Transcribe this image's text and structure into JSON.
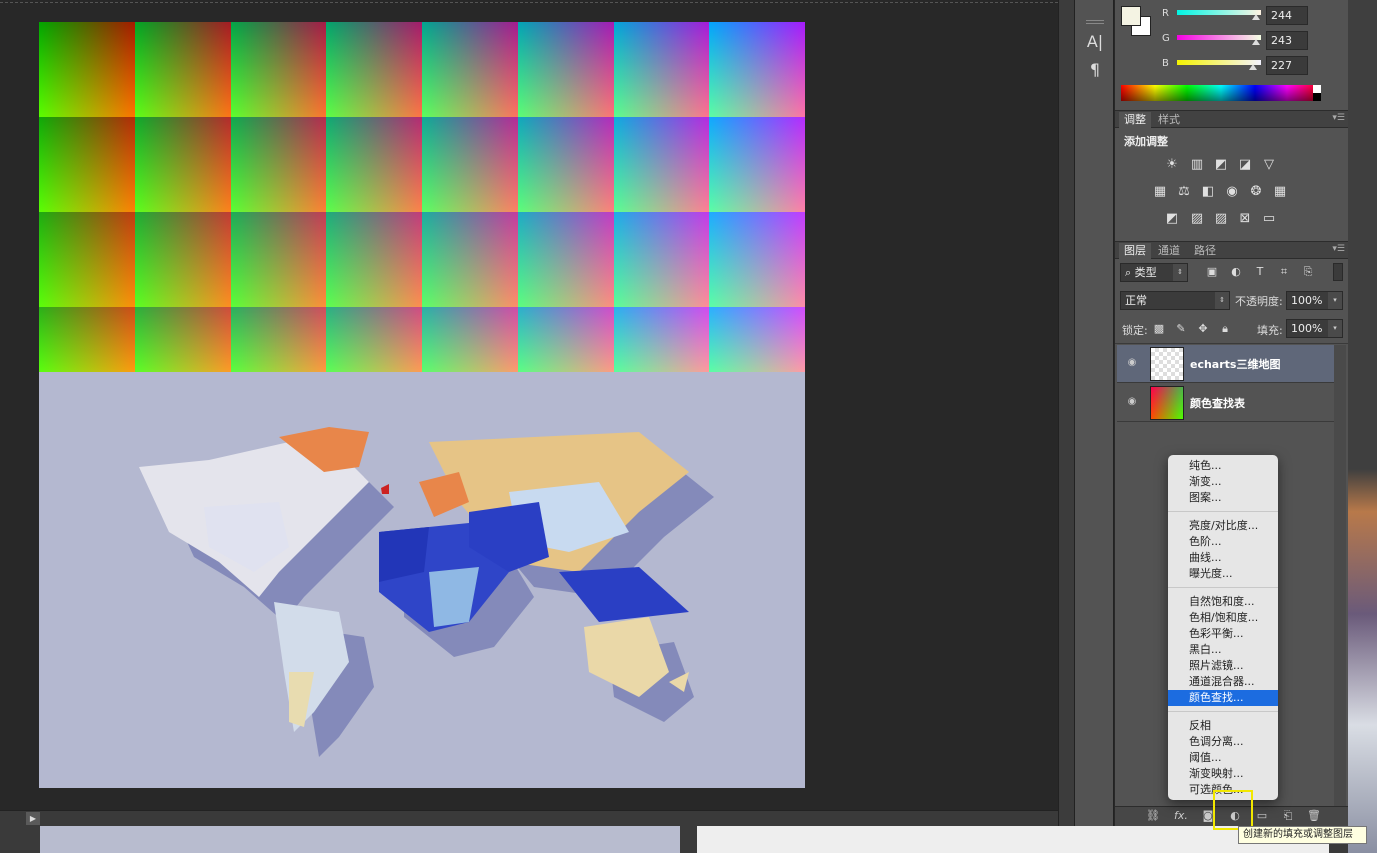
{
  "color_panel": {
    "foreground_hex": "#f4f3e3",
    "background_hex": "#ffffff",
    "channels": [
      {
        "label": "R",
        "value": "244"
      },
      {
        "label": "G",
        "value": "243"
      },
      {
        "label": "B",
        "value": "227"
      }
    ]
  },
  "tools": {
    "text_icon": "A|",
    "paragraph_icon": "¶"
  },
  "adjustments_panel": {
    "tabs": [
      "调整",
      "样式"
    ],
    "title": "添加调整",
    "icons_row1": [
      "brightness-icon",
      "levels-icon",
      "curves-icon",
      "exposure-icon",
      "vibrance-icon"
    ],
    "icons_row2": [
      "hue-saturation-icon",
      "color-balance-icon",
      "black-white-icon",
      "photo-filter-icon",
      "channel-mixer-icon",
      "color-lookup-icon"
    ],
    "icons_row3": [
      "invert-icon",
      "posterize-icon",
      "threshold-icon",
      "selective-color-icon",
      "gradient-map-icon"
    ]
  },
  "layers_panel": {
    "tabs": [
      "图层",
      "通道",
      "路径"
    ],
    "filter_kind": "类型",
    "blend_mode": "正常",
    "opacity_label": "不透明度:",
    "opacity_value": "100%",
    "lock_label": "锁定:",
    "fill_label": "填充:",
    "fill_value": "100%",
    "layers": [
      {
        "name": "echarts三维地图",
        "selected": true,
        "visible": true
      },
      {
        "name": "颜色查找表",
        "selected": false,
        "visible": true
      }
    ]
  },
  "adjustment_menu": {
    "groups": [
      [
        "纯色...",
        "渐变...",
        "图案..."
      ],
      [
        "亮度/对比度...",
        "色阶...",
        "曲线...",
        "曝光度..."
      ],
      [
        "自然饱和度...",
        "色相/饱和度...",
        "色彩平衡...",
        "黑白...",
        "照片滤镜...",
        "通道混合器...",
        "颜色查找..."
      ],
      [
        "反相",
        "色调分离...",
        "阈值...",
        "渐变映射...",
        "可选颜色..."
      ]
    ],
    "highlighted": "颜色查找..."
  },
  "tooltip": "创建新的填充或调整图层",
  "layer_bar_icons": [
    "link-icon",
    "fx-icon",
    "mask-icon",
    "new-adjustment-icon",
    "folder-icon",
    "new-layer-icon",
    "trash-icon"
  ],
  "layer_bar_fx": "fx."
}
